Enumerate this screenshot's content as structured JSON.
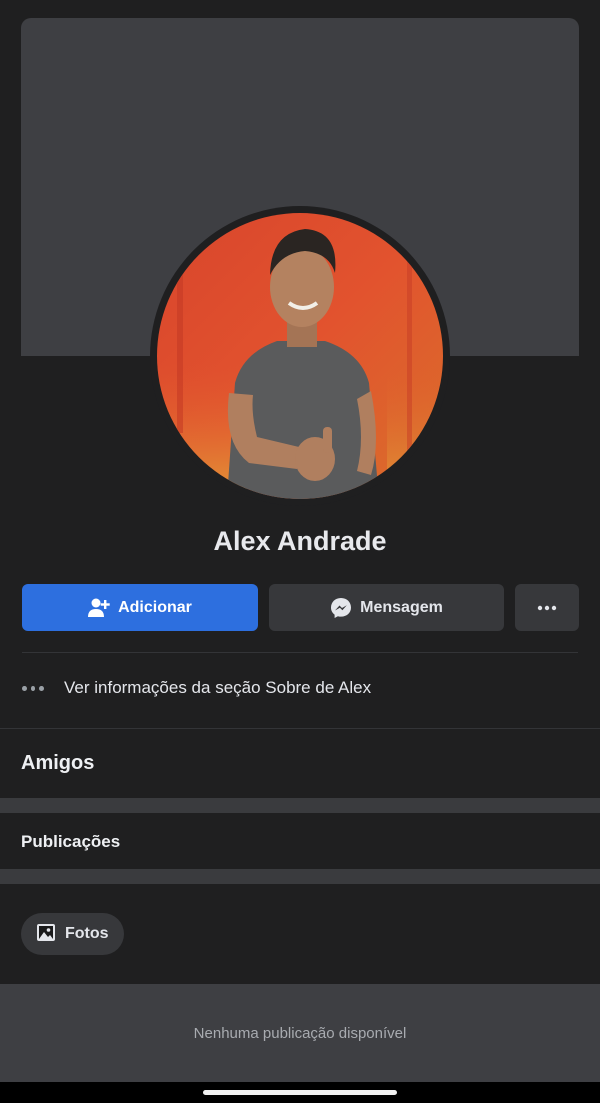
{
  "profile": {
    "name": "Alex Andrade"
  },
  "actions": {
    "add_label": "Adicionar",
    "message_label": "Mensagem",
    "more_icon": "more-horizontal-icon"
  },
  "about": {
    "label": "Ver informações da seção Sobre de Alex"
  },
  "sections": {
    "friends_title": "Amigos",
    "posts_title": "Publicações",
    "photos_chip": "Fotos"
  },
  "feed": {
    "empty_message": "Nenhuma publicação disponível"
  },
  "colors": {
    "background": "#1f1f20",
    "primary_button": "#2d6fdf",
    "secondary_button": "#37383b",
    "cover": "#3e3f43"
  }
}
